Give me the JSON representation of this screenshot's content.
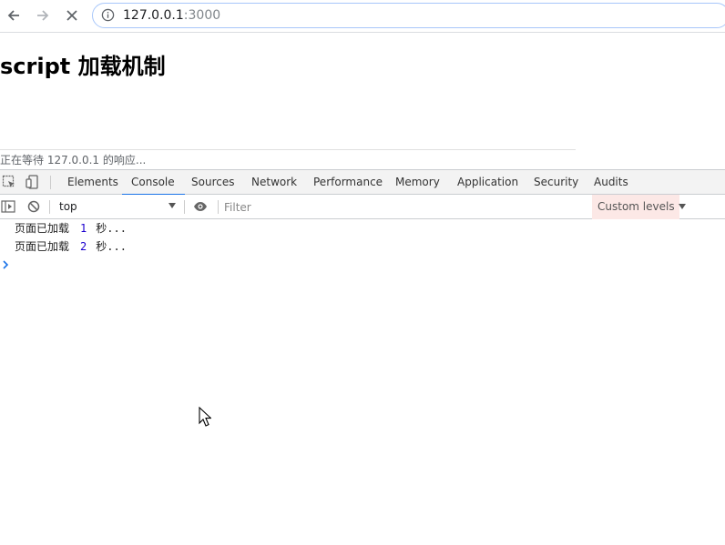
{
  "browser": {
    "url_host": "127.0.0.1",
    "url_port": ":3000",
    "icons": [
      "back-arrow-icon",
      "forward-arrow-icon",
      "stop-loading-icon",
      "site-info-icon"
    ]
  },
  "page": {
    "title": "script 加载机制",
    "status": "正在等待 127.0.0.1 的响应..."
  },
  "devtools": {
    "tabs": [
      "Elements",
      "Console",
      "Sources",
      "Network",
      "Performance",
      "Memory",
      "Application",
      "Security",
      "Audits"
    ],
    "active_tab": "Console",
    "context": "top",
    "filter_placeholder": "Filter",
    "levels_label": "Custom levels",
    "colors": {
      "accent": "#1a73e8",
      "levels_bg": "#fce8e6",
      "log_number": "#1c00cf"
    },
    "logs": [
      {
        "text": "页面已加载",
        "num": "1",
        "suffix": "秒..."
      },
      {
        "text": "页面已加载",
        "num": "2",
        "suffix": "秒..."
      }
    ]
  }
}
